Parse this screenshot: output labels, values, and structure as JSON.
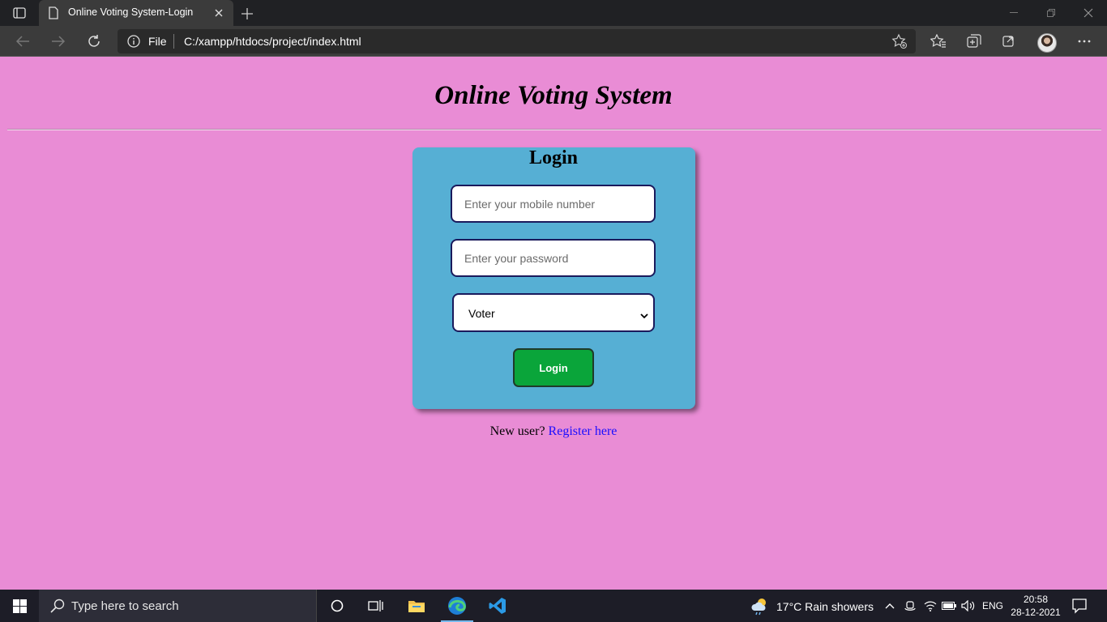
{
  "browser": {
    "tab_title": "Online Voting System-Login",
    "address_scheme": "File",
    "address_url": "C:/xampp/htdocs/project/index.html"
  },
  "page": {
    "title": "Online Voting System",
    "login_heading": "Login",
    "mobile_placeholder": "Enter your mobile number",
    "password_placeholder": "Enter your password",
    "role_selected": "Voter",
    "login_button": "Login",
    "new_user_text": "New user? ",
    "register_link": "Register here"
  },
  "taskbar": {
    "search_placeholder": "Type here to search",
    "weather": "17°C  Rain showers",
    "language": "ENG",
    "time": "20:58",
    "date": "28-12-2021"
  },
  "icons": [
    "tab-actions-icon",
    "page-icon",
    "close-icon",
    "plus-icon",
    "minimize-icon",
    "restore-icon",
    "window-close-icon",
    "back-icon",
    "forward-icon",
    "refresh-icon",
    "info-icon",
    "add-favorite-icon",
    "favorites-icon",
    "collections-icon",
    "share-icon",
    "more-icon",
    "windows-start-icon",
    "search-icon",
    "cortana-icon",
    "task-view-icon",
    "file-explorer-icon",
    "edge-icon",
    "vscode-icon",
    "weather-icon",
    "chevron-up-icon",
    "meet-icon",
    "wifi-icon",
    "battery-icon",
    "volume-icon",
    "notification-icon"
  ],
  "colors": {
    "page_background": "#e98cd5",
    "card_background": "#56afd4",
    "login_button": "#0aa53a",
    "link": "#1a0dff"
  }
}
